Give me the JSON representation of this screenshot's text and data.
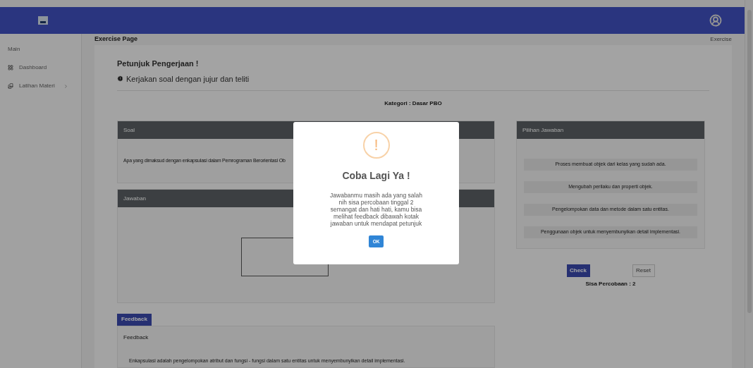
{
  "sidebar": {
    "section": "Main",
    "items": [
      {
        "label": "Dashboard",
        "expandable": false
      },
      {
        "label": "Latihan Materi",
        "expandable": true
      }
    ]
  },
  "page": {
    "title": "Exercise Page",
    "breadcrumb": "Exercise"
  },
  "instructions": {
    "title": "Petunjuk Pengerjaan !",
    "items": [
      "Kerjakan soal dengan jujur dan teliti"
    ]
  },
  "category": "Kategori : Dasar PBO",
  "question": {
    "header": "Soal",
    "text": "Apa yang dimaksud dengan enkapsulasi dalam Pemrograman Berorientasi Ob"
  },
  "answer": {
    "header": "Jawaban"
  },
  "options": {
    "header": "Pilihan Jawaban",
    "items": [
      "Proses membuat objek dari kelas yang sudah ada.",
      "Mengubah perilaku dan properti objek.",
      "Pengelompokan data dan metode dalam satu entitas.",
      "Penggunaan objek untuk menyembunyikan detail implementasi."
    ]
  },
  "buttons": {
    "check": "Check",
    "reset": "Reset"
  },
  "attempts": "Sisa Percobaan : 2",
  "feedback": {
    "button": "Feedback",
    "title": "Feedback",
    "text": "Enkapsulasi adalah pengelompokan atribut dan fungsi - fungsi dalam satu entitas untuk menyembunyikan detail implementasi."
  },
  "modal": {
    "icon": "!",
    "title": "Coba Lagi Ya !",
    "message": "Jawabanmu masih ada yang salah nih sisa percobaan tinggal 2 semangat dan hati hati, kamu bisa melihat feedback dibawah kotak jawaban untuk mendapat petunjuk",
    "button": "OK"
  }
}
